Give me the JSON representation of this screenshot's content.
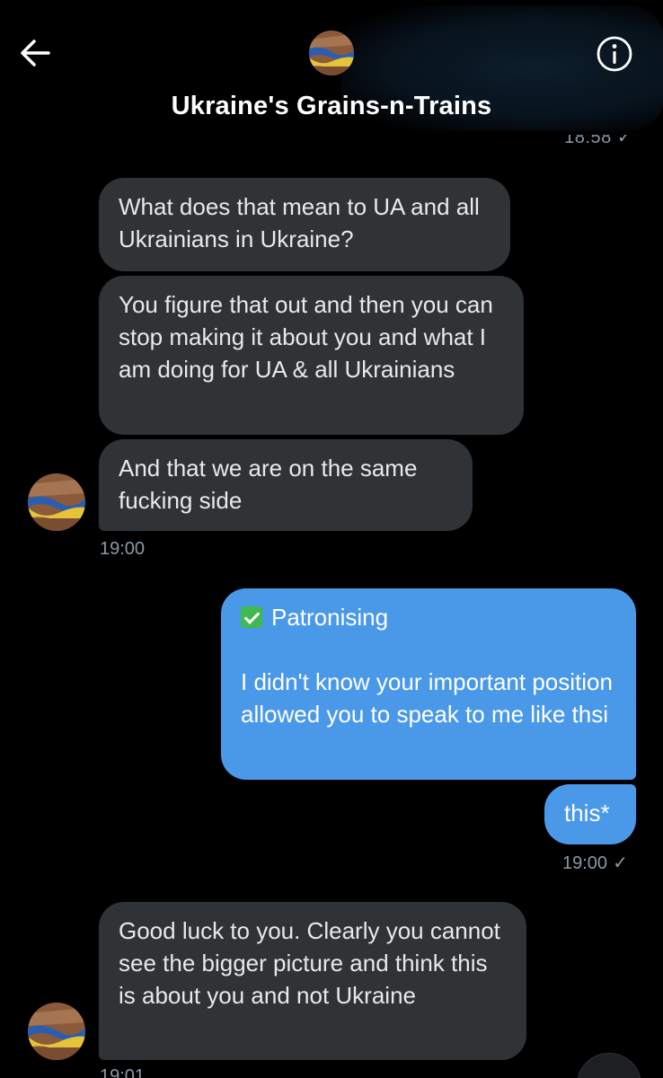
{
  "header": {
    "title": "Ukraine's Grains-n-Trains",
    "back_icon": "arrow-left-icon",
    "info_icon": "info-icon"
  },
  "status_top": "18:58",
  "messages": {
    "m1": "What does that mean to UA and all Ukrainians in Ukraine?",
    "m2": "You figure that out and then you can stop making it about you and what I am doing for UA & all Ukrainians",
    "m3": "And that we are on the same fucking side",
    "t1": "19:00",
    "o1_title": "Patronising",
    "o1_body": "I didn't know your important position allowed you to speak to me like thsi",
    "o2": "this*",
    "t2": "19:00",
    "m4": "Good luck to you. Clearly you cannot see the bigger picture and think this is about you and not Ukraine",
    "t3": "19:01"
  },
  "colors": {
    "background": "#000000",
    "incoming_bubble": "#2f3336",
    "outgoing_bubble": "#4a99e9",
    "muted_text": "#8b98a5"
  }
}
